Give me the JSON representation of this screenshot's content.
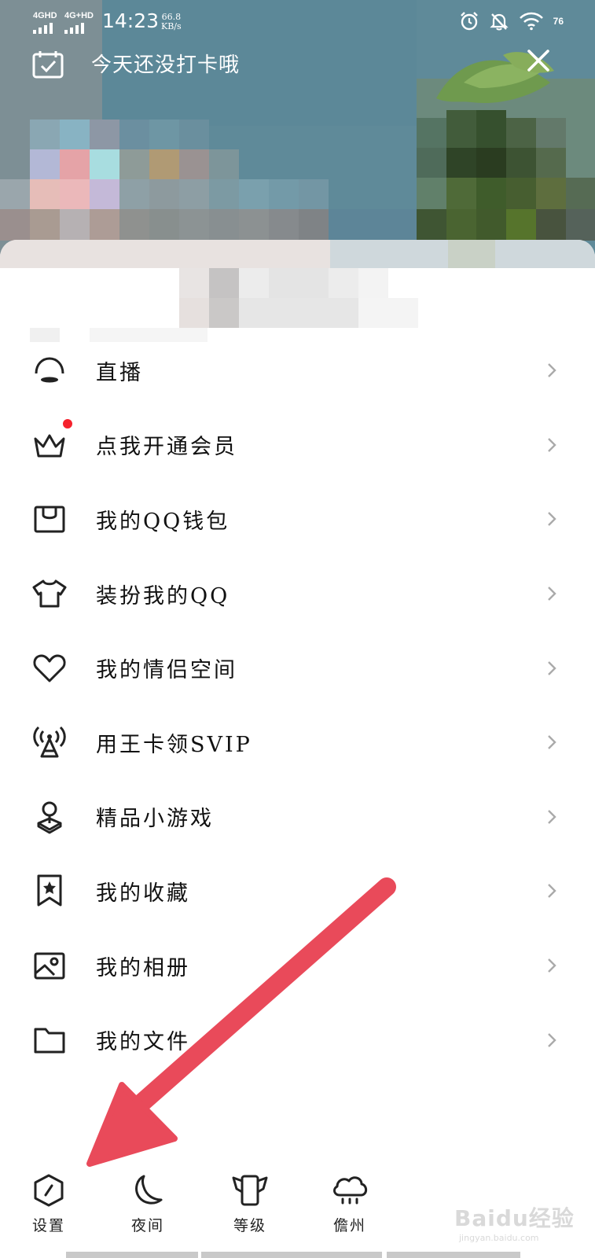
{
  "status_bar": {
    "network_1": "4GHD",
    "network_2": "4G+HD",
    "time": "14:23",
    "speed_value": "66.8",
    "speed_unit": "KB/s",
    "battery": "76",
    "icons": [
      "alarm-icon",
      "bell-off-icon",
      "wifi-icon",
      "battery-icon"
    ]
  },
  "header": {
    "checkin_text": "今天还没打卡哦",
    "checkin_icon": "calendar-check-icon",
    "close_icon": "close-icon"
  },
  "menu": {
    "items": [
      {
        "label": "直播",
        "icon": "live-icon",
        "badge": false
      },
      {
        "label": "点我开通会员",
        "icon": "crown-icon",
        "badge": true
      },
      {
        "label": "我的QQ钱包",
        "icon": "wallet-icon",
        "badge": false
      },
      {
        "label": "装扮我的QQ",
        "icon": "shirt-icon",
        "badge": false
      },
      {
        "label": "我的情侣空间",
        "icon": "heart-icon",
        "badge": false
      },
      {
        "label": "用王卡领SVIP",
        "icon": "signal-tower-icon",
        "badge": false
      },
      {
        "label": "精品小游戏",
        "icon": "game-icon",
        "badge": false
      },
      {
        "label": "我的收藏",
        "icon": "bookmark-star-icon",
        "badge": false
      },
      {
        "label": "我的相册",
        "icon": "photo-icon",
        "badge": false
      },
      {
        "label": "我的文件",
        "icon": "folder-icon",
        "badge": false
      }
    ]
  },
  "toolbar": {
    "settings": "设置",
    "night": "夜间",
    "level": "等级",
    "weather": "儋州"
  },
  "colors": {
    "badge": "#f5222d",
    "arrow": "#e94a5a",
    "header_bg": "#5f8998"
  },
  "watermark": {
    "main": "Baidu经验",
    "sub": "jingyan.baidu.com"
  }
}
